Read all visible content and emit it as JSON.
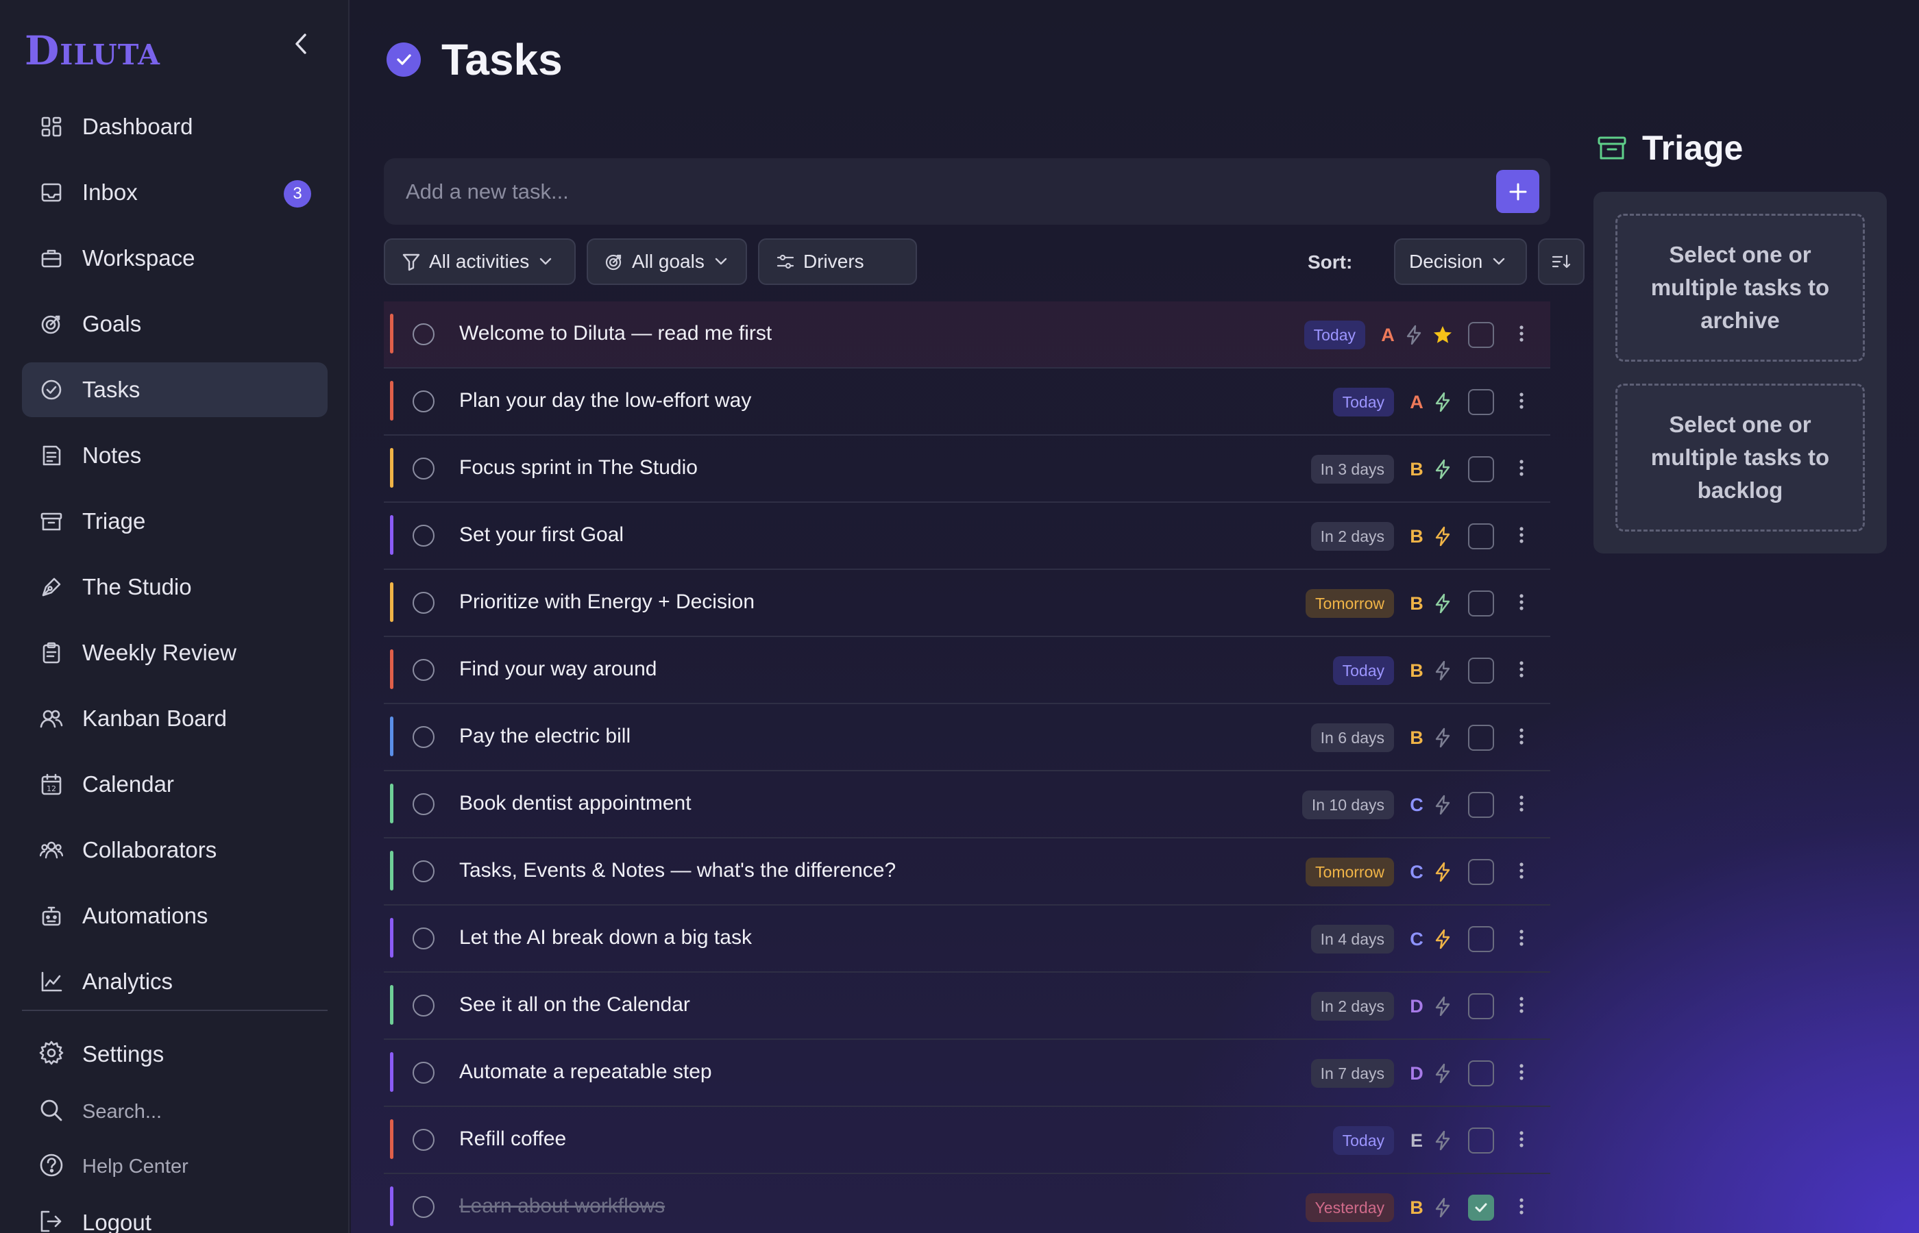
{
  "app": {
    "logo": "Diluta"
  },
  "sidebar": {
    "items": [
      {
        "label": "Dashboard",
        "icon": "dashboard-icon"
      },
      {
        "label": "Inbox",
        "icon": "inbox-icon",
        "badge": "3"
      },
      {
        "label": "Workspace",
        "icon": "briefcase-icon"
      },
      {
        "label": "Goals",
        "icon": "target-icon"
      },
      {
        "label": "Tasks",
        "icon": "check-circle-icon",
        "active": true
      },
      {
        "label": "Notes",
        "icon": "note-icon"
      },
      {
        "label": "Triage",
        "icon": "archive-icon"
      },
      {
        "label": "The Studio",
        "icon": "pen-tool-icon"
      },
      {
        "label": "Weekly Review",
        "icon": "clipboard-icon"
      },
      {
        "label": "Kanban Board",
        "icon": "users-icon"
      },
      {
        "label": "Calendar",
        "icon": "calendar-icon"
      },
      {
        "label": "Collaborators",
        "icon": "group-icon"
      },
      {
        "label": "Automations",
        "icon": "robot-icon"
      },
      {
        "label": "Analytics",
        "icon": "chart-line-icon"
      }
    ],
    "settings": "Settings",
    "search": "Search...",
    "help": "Help Center",
    "logout": "Logout"
  },
  "header": {
    "title": "Tasks"
  },
  "add_task": {
    "placeholder": "Add a new task..."
  },
  "filters": {
    "activities": "All activities",
    "goals": "All goals",
    "drivers": "Drivers",
    "sort_label": "Sort:",
    "sort_value": "Decision"
  },
  "colors": {
    "accent": "#6b5ce7",
    "grade_A": "#ef7a5a",
    "grade_B": "#f0b447",
    "grade_C": "#8d93ff",
    "grade_D": "#a77ae8",
    "grade_E": "#b8b8c8",
    "bolt_active": "#8fd0a2",
    "bolt_active_yellow": "#f0b447",
    "bolt_muted": "#7c7e92"
  },
  "tasks": [
    {
      "title": "Welcome to Diluta — read me first",
      "due": "Today",
      "due_kind": "today",
      "grade": "A",
      "bar": "#e0604a",
      "bolt": "muted",
      "star": true,
      "done": false
    },
    {
      "title": "Plan your day the low-effort way",
      "due": "Today",
      "due_kind": "today",
      "grade": "A",
      "bar": "#e0604a",
      "bolt": "green",
      "star": false,
      "done": false
    },
    {
      "title": "Focus sprint in The Studio",
      "due": "In 3 days",
      "due_kind": "future",
      "grade": "B",
      "bar": "#f0b447",
      "bolt": "green",
      "star": false,
      "done": false
    },
    {
      "title": "Set your first Goal",
      "due": "In 2 days",
      "due_kind": "future",
      "grade": "B",
      "bar": "#8b5cf6",
      "bolt": "yellow",
      "star": false,
      "done": false
    },
    {
      "title": "Prioritize with Energy + Decision",
      "due": "Tomorrow",
      "due_kind": "tomorrow",
      "grade": "B",
      "bar": "#f0b447",
      "bolt": "green",
      "star": false,
      "done": false
    },
    {
      "title": "Find your way around",
      "due": "Today",
      "due_kind": "today",
      "grade": "B",
      "bar": "#e0604a",
      "bolt": "muted",
      "star": false,
      "done": false
    },
    {
      "title": "Pay the electric bill",
      "due": "In 6 days",
      "due_kind": "future",
      "grade": "B",
      "bar": "#5b8fe8",
      "bolt": "muted",
      "star": false,
      "done": false
    },
    {
      "title": "Book dentist appointment",
      "due": "In 10 days",
      "due_kind": "future",
      "grade": "C",
      "bar": "#6fcf97",
      "bolt": "muted",
      "star": false,
      "done": false
    },
    {
      "title": "Tasks, Events & Notes — what's the difference?",
      "due": "Tomorrow",
      "due_kind": "tomorrow",
      "grade": "C",
      "bar": "#6fcf97",
      "bolt": "yellow",
      "star": false,
      "done": false
    },
    {
      "title": "Let the AI break down a big task",
      "due": "In 4 days",
      "due_kind": "future",
      "grade": "C",
      "bar": "#8b5cf6",
      "bolt": "yellow",
      "star": false,
      "done": false
    },
    {
      "title": "See it all on the Calendar",
      "due": "In 2 days",
      "due_kind": "future",
      "grade": "D",
      "bar": "#6fcf97",
      "bolt": "muted",
      "star": false,
      "done": false
    },
    {
      "title": "Automate a repeatable step",
      "due": "In 7 days",
      "due_kind": "future",
      "grade": "D",
      "bar": "#8b5cf6",
      "bolt": "muted",
      "star": false,
      "done": false
    },
    {
      "title": "Refill coffee",
      "due": "Today",
      "due_kind": "today",
      "grade": "E",
      "bar": "#e0604a",
      "bolt": "muted",
      "star": false,
      "done": false
    },
    {
      "title": "Learn about workflows",
      "due": "Yesterday",
      "due_kind": "yesterday",
      "grade": "B",
      "bar": "#8b5cf6",
      "bolt": "muted",
      "star": false,
      "done": true
    }
  ],
  "triage": {
    "title": "Triage",
    "archive_hint": "Select one or multiple tasks to archive",
    "backlog_hint": "Select one or multiple tasks to backlog"
  }
}
